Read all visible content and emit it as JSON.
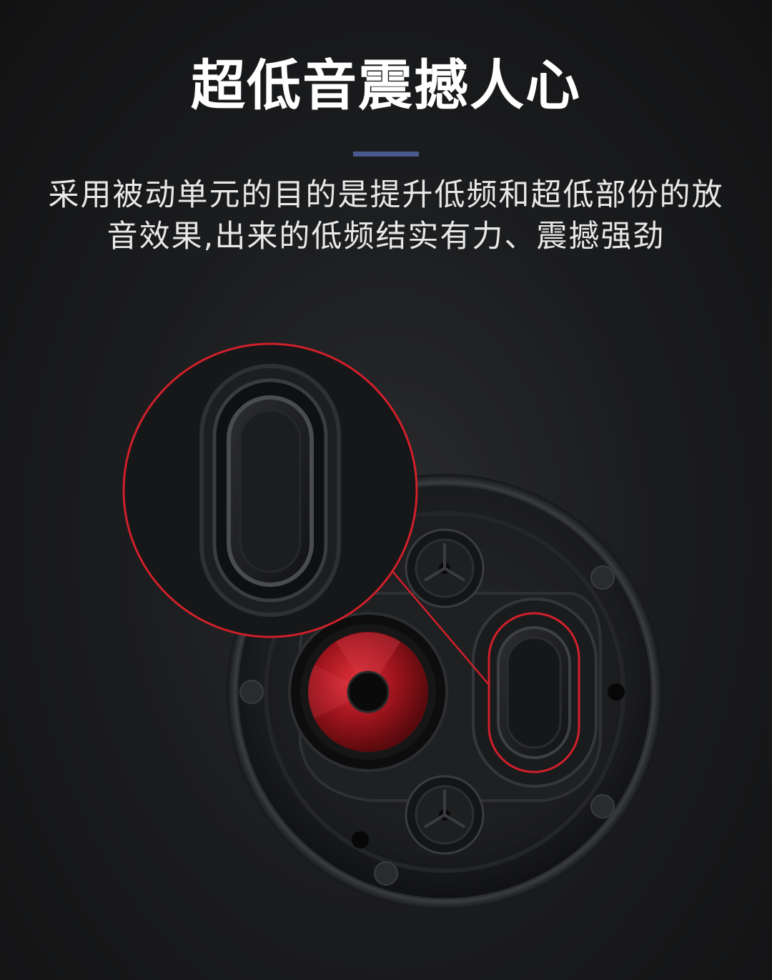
{
  "headline": "超低音震撼人心",
  "description": {
    "line1": "采用被动单元的目的是提升低频和超低部份的放",
    "line2": "音效果,出来的低频结实有力、震撼强劲"
  },
  "colors": {
    "background": "#1c1d1f",
    "accent_bar": "#4a5a8e",
    "highlight_red": "#d0202a",
    "driver_red": "#b01a22"
  },
  "icons": {
    "speaker_bottom_view": "speaker-base-illustration",
    "passive_radiator_zoom": "magnifier-callout"
  }
}
